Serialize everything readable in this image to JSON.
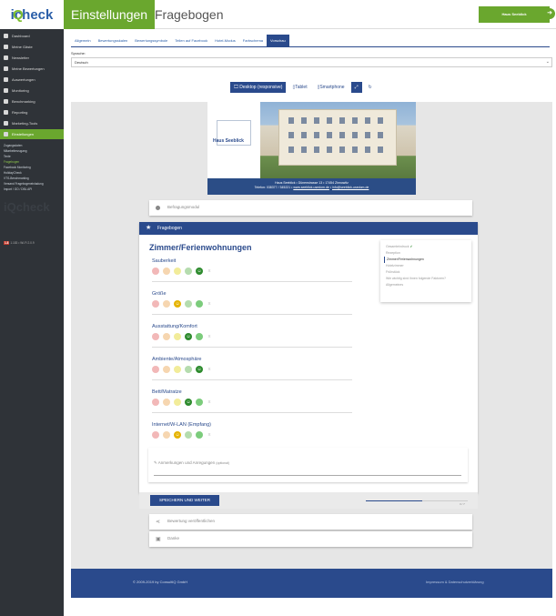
{
  "logo": {
    "text_a": "i",
    "text_q": "Q",
    "text_b": "check"
  },
  "header": {
    "section": "Einstellungen",
    "page": "Fragebogen",
    "user": "Haus Seeblick",
    "logout_icon": "logout-icon"
  },
  "sidebar": {
    "items": [
      {
        "label": "Dashboard",
        "icon": "dashboard-icon"
      },
      {
        "label": "Meine Gäste",
        "icon": "guests-icon"
      },
      {
        "label": "Newsletter",
        "icon": "newsletter-icon"
      },
      {
        "label": "Meine Bewertungen",
        "icon": "star-icon"
      },
      {
        "label": "Auswertungen",
        "icon": "chart-icon"
      },
      {
        "label": "Monitoring",
        "icon": "monitor-icon"
      },
      {
        "label": "Benchmarking",
        "icon": "benchmark-icon"
      },
      {
        "label": "Reporting",
        "icon": "report-icon"
      },
      {
        "label": "Marketing-Tools",
        "icon": "megaphone-icon"
      },
      {
        "label": "Einstellungen",
        "icon": "settings-icon"
      }
    ],
    "subitems": [
      "Zugangsdaten",
      "Mitarbeiterzugang",
      "Texte",
      "Fragebogen",
      "Facebook Monitoring",
      "HolidayCheck",
      "VTS-Benchmarking",
      "Versand Fragebogeneinladung",
      "Import / GO / DBL API"
    ],
    "watermark": "iQcheck",
    "version_badge": "1.8",
    "version_text": "1.183 • Wi-Fi 2.0.9"
  },
  "tabs": [
    "Allgemein",
    "Bewertungsskalen",
    "Bewertungssymbole",
    "Teilen auf Facebook",
    "Hotel-Modus",
    "Farbschema",
    "Vorschau"
  ],
  "language": {
    "label": "Sprache:",
    "value": "Deutsch"
  },
  "viewbar": {
    "desktop": "Desktop (responsive)",
    "tablet": "Tablet",
    "smartphone": "Smartphone"
  },
  "hero": {
    "logo_name": "Haus Seeblick",
    "line1": "Haus Seeblick • Dünenstrasse 13 • 17454 Zinnowitz",
    "line2_prefix": "Telefon: 038377 / 345221 • ",
    "website": "www.seeblick-usedom.de",
    "sep": " • ",
    "email": "info@seeblick-usedom.de"
  },
  "modul": {
    "label": "Befragungsmodul"
  },
  "frage": {
    "header": "Fragebogen",
    "title": "Zimmer/Ferienwohnungen",
    "questions": [
      {
        "label": "Sauberkeit",
        "selected": 5
      },
      {
        "label": "Größe",
        "selected": 3
      },
      {
        "label": "Ausstattung/Komfort",
        "selected": 4
      },
      {
        "label": "Ambiente/Atmosphäre",
        "selected": 5
      },
      {
        "label": "Bett/Matratze",
        "selected": 4
      },
      {
        "label": "Internet/W-LAN (Empfang)",
        "selected": 3
      }
    ],
    "na": "X",
    "toc": [
      "Gesamteindruck",
      "Rezeption",
      "Zimmer/Ferienwohnungen",
      "Hotelzimmer",
      "Frühstück",
      "Wie wichtig sind Ihnen folgende Faktoren?",
      "Allgemeines"
    ],
    "toc_check": "✔",
    "note": {
      "label": "Anmerkungen und Anregungen",
      "optional": "(optional)"
    },
    "save": "SPEICHERN UND WEITER",
    "progress": 0.55,
    "progress_text": "3 / 7"
  },
  "publish": {
    "label": "Bewertung veröffentlichen"
  },
  "thanks": {
    "label": "Danke"
  },
  "footer": {
    "copyright": "© 2009-2019 by ConsultIQ GmbH",
    "links": "Impressum & Datenschutzerklärung"
  }
}
